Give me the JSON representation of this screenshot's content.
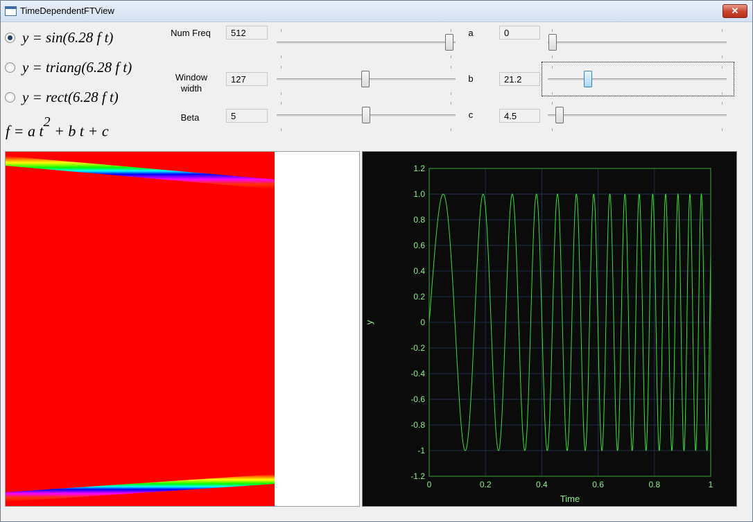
{
  "window": {
    "title": "TimeDependentFTView",
    "close_label": "✕"
  },
  "functions": [
    {
      "label": "y = sin(6.28 f t)",
      "checked": true
    },
    {
      "label": "y = triang(6.28 f t)",
      "checked": false
    },
    {
      "label": "y = rect(6.28 f t)",
      "checked": false
    }
  ],
  "formula": {
    "lhs": "f = a t",
    "exp": "2",
    "rhs": " + b t + c"
  },
  "params": {
    "num_freq": {
      "label": "Num Freq",
      "value": "512"
    },
    "window_width": {
      "label": "Window width",
      "value": "127"
    },
    "beta": {
      "label": "Beta",
      "value": "5"
    },
    "a": {
      "label": "a",
      "value": "0"
    },
    "b": {
      "label": "b",
      "value": "21.2"
    },
    "c": {
      "label": "c",
      "value": "4.5"
    }
  },
  "colors": {
    "plot_bg": "#0b0b0b",
    "trace": "#35e62f",
    "grid": "#1f2f4f",
    "axis_text": "#8ef28a",
    "spectro_bg": "#ff0000"
  },
  "chart_data": {
    "type": "line",
    "xlabel": "Time",
    "ylabel": "y",
    "xlim": [
      0,
      1
    ],
    "ylim": [
      -1.2,
      1.2
    ],
    "x_ticks": [
      "0",
      "0.2",
      "0.4",
      "0.6",
      "0.8",
      "1"
    ],
    "y_ticks": [
      "1.2",
      "1.0",
      "0.8",
      "0.6",
      "0.4",
      "0.2",
      "0",
      "-0.2",
      "-0.4",
      "-0.6",
      "-0.8",
      "-1",
      "-1.2"
    ],
    "grid": true,
    "series": [
      {
        "function": "sin",
        "a": 0,
        "b": 21.2,
        "c": 4.5,
        "x_start": 0,
        "x_end": 1
      }
    ]
  }
}
